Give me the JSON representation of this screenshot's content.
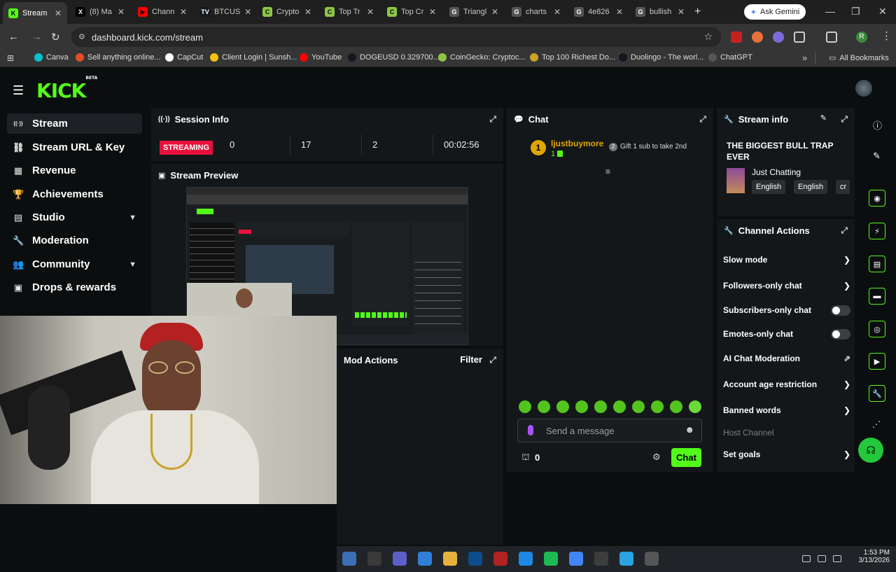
{
  "browser": {
    "tabs": [
      {
        "label": "Stream",
        "active": true,
        "icon_color": "#53fc18",
        "icon": "K"
      },
      {
        "label": "(8) Ma",
        "icon_color": "#000000",
        "icon": "X"
      },
      {
        "label": "Chann",
        "icon_color": "#ff0000",
        "icon": "▶"
      },
      {
        "label": "BTCUS",
        "icon_color": "#131722",
        "icon": "TV"
      },
      {
        "label": "Crypto",
        "icon_color": "#8dc647",
        "icon": "C"
      },
      {
        "label": "Top Tr",
        "icon_color": "#8dc647",
        "icon": "C"
      },
      {
        "label": "Top Cr",
        "icon_color": "#8dc647",
        "icon": "C"
      },
      {
        "label": "Triangl",
        "icon_color": "#555555",
        "icon": "G"
      },
      {
        "label": "charts",
        "icon_color": "#555555",
        "icon": "G"
      },
      {
        "label": "4e826",
        "icon_color": "#555555",
        "icon": "G"
      },
      {
        "label": "bullish",
        "icon_color": "#555555",
        "icon": "G"
      }
    ],
    "new_tab": "+",
    "gemini_label": "Ask Gemini",
    "url": "dashboard.kick.com/stream",
    "bookmarks": [
      {
        "label": "Canva",
        "color": "#00c4cc"
      },
      {
        "label": "Sell anything online...",
        "color": "#e44d26"
      },
      {
        "label": "CapCut",
        "color": "#ffffff"
      },
      {
        "label": "Client Login | Sunsh...",
        "color": "#f4c20d"
      },
      {
        "label": "YouTube",
        "color": "#ff0000"
      },
      {
        "label": "DOGEUSD 0.329700...",
        "color": "#131722"
      },
      {
        "label": "CoinGecko: Cryptoc...",
        "color": "#8dc647"
      },
      {
        "label": "Top 100 Richest Do...",
        "color": "#c9a227"
      },
      {
        "label": "Duolingo - The worl...",
        "color": "#131722"
      },
      {
        "label": "ChatGPT",
        "color": "#555555"
      }
    ],
    "more_bookmarks": "»",
    "all_bookmarks": "All Bookmarks"
  },
  "brand": {
    "logo": "KICK",
    "beta": "BETA",
    "accent": "#53fc18"
  },
  "sidebar": {
    "items": [
      {
        "label": "Stream",
        "icon": "broadcast-icon",
        "glyph": "((·))",
        "active": true
      },
      {
        "label": "Stream URL & Key",
        "icon": "link-icon",
        "glyph": "⛓"
      },
      {
        "label": "Revenue",
        "icon": "bank-icon",
        "glyph": "▦"
      },
      {
        "label": "Achievements",
        "icon": "trophy-icon",
        "glyph": "🏆"
      },
      {
        "label": "Studio",
        "icon": "studio-icon",
        "glyph": "▤",
        "chevron": "▼"
      },
      {
        "label": "Moderation",
        "icon": "wrench-icon",
        "glyph": "🔧"
      },
      {
        "label": "Community",
        "icon": "users-icon",
        "glyph": "👥",
        "chevron": "▼"
      },
      {
        "label": "Drops & rewards",
        "icon": "gift-icon",
        "glyph": "▣"
      }
    ]
  },
  "session": {
    "title": "Session Info",
    "status": "STREAMING",
    "viewers": "0",
    "followers": "17",
    "subs": "2",
    "duration": "00:02:56"
  },
  "preview": {
    "title": "Stream Preview"
  },
  "mod_actions": {
    "title": "Mod Actions",
    "filter": "Filter"
  },
  "chat": {
    "title": "Chat",
    "pinned_user": "ljustbuymore",
    "pinned_badge": "1",
    "pinned_count": "1",
    "gift_text": "Gift 1 sub to take 2nd",
    "placeholder": "Send a message",
    "viewer_count": "0",
    "send_label": "Chat"
  },
  "stream_info": {
    "title": "Stream info",
    "stream_title": "THE BIGGEST BULL TRAP EVER",
    "category": "Just Chatting",
    "tags": [
      "English",
      "English",
      "cr"
    ]
  },
  "channel_actions": {
    "title": "Channel Actions",
    "rows": [
      {
        "label": "Slow mode",
        "type": "arrow"
      },
      {
        "label": "Followers-only chat",
        "type": "arrow"
      },
      {
        "label": "Subscribers-only chat",
        "type": "toggle",
        "on": false
      },
      {
        "label": "Emotes-only chat",
        "type": "toggle",
        "on": false
      },
      {
        "label": "AI Chat Moderation",
        "type": "external"
      },
      {
        "label": "Account age restriction",
        "type": "arrow"
      },
      {
        "label": "Banned words",
        "type": "arrow"
      },
      {
        "label": "Host Channel",
        "type": "disabled"
      },
      {
        "label": "Set goals",
        "type": "arrow"
      }
    ]
  },
  "taskbar": {
    "time": "1:53 PM",
    "date": "3/13/2026"
  }
}
